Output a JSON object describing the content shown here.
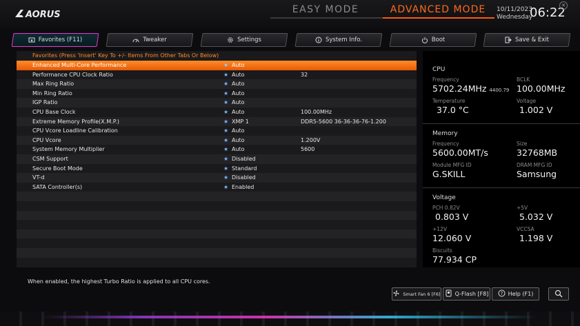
{
  "header": {
    "logo_text": "AORUS",
    "easy_mode": "EASY MODE",
    "advanced_mode": "ADVANCED MODE",
    "date": "10/11/2023",
    "weekday": "Wednesday",
    "time": "06:22",
    "accent_color": "#ff5a0a"
  },
  "tabs": [
    {
      "label": "Favorites (F11)",
      "icon": "favorites-icon",
      "active": true
    },
    {
      "label": "Tweaker",
      "icon": "speedometer-icon",
      "active": false
    },
    {
      "label": "Settings",
      "icon": "gear-icon",
      "active": false
    },
    {
      "label": "System Info.",
      "icon": "info-icon",
      "active": false
    },
    {
      "label": "Boot",
      "icon": "power-icon",
      "active": false
    },
    {
      "label": "Save & Exit",
      "icon": "exit-icon",
      "active": false
    }
  ],
  "favorites": {
    "title": "Favorites (Press 'Insert' Key To +/- Items From Other Tabs Or Below)",
    "rows": [
      {
        "name": "Enhanced Multi-Core Performance",
        "value": "Auto",
        "extra": ""
      },
      {
        "name": "Performance CPU Clock Ratio",
        "value": "Auto",
        "extra": "32"
      },
      {
        "name": "Max Ring Ratio",
        "value": "Auto",
        "extra": ""
      },
      {
        "name": "Min Ring Ratio",
        "value": "Auto",
        "extra": ""
      },
      {
        "name": "IGP Ratio",
        "value": "Auto",
        "extra": ""
      },
      {
        "name": "CPU Base Clock",
        "value": "Auto",
        "extra": "100.00MHz"
      },
      {
        "name": "Extreme Memory Profile(X.M.P.)",
        "value": "XMP 1",
        "extra": "DDR5-5600 36-36-36-76-1.200"
      },
      {
        "name": "CPU Vcore Loadline Calibration",
        "value": "Auto",
        "extra": ""
      },
      {
        "name": "CPU Vcore",
        "value": "Auto",
        "extra": "1.200V"
      },
      {
        "name": "System Memory Multiplier",
        "value": "Auto",
        "extra": "5600"
      },
      {
        "name": "CSM Support",
        "value": "Disabled",
        "extra": ""
      },
      {
        "name": "Secure Boot Mode",
        "value": "Standard",
        "extra": ""
      },
      {
        "name": "VT-d",
        "value": "Disabled",
        "extra": ""
      },
      {
        "name": "SATA Controller(s)",
        "value": "Enabled",
        "extra": ""
      }
    ]
  },
  "help_text": "When enabled, the highest Turbo Ratio is applied to all CPU cores.",
  "cpu": {
    "title": "CPU",
    "frequency_label": "Frequency",
    "frequency": "5702.24MHz",
    "frequency_sub": "4400.79",
    "bclk_label": "BCLK",
    "bclk": "100.00MHz",
    "temperature_label": "Temperature",
    "temperature": "37.0 °C",
    "voltage_label": "Voltage",
    "voltage": "1.002 V"
  },
  "memory": {
    "title": "Memory",
    "frequency_label": "Frequency",
    "frequency": "5600.00MT/s",
    "size_label": "Size",
    "size": "32768MB",
    "module_label": "Module MFG ID",
    "module": "G.SKILL",
    "dram_label": "DRAM MFG ID",
    "dram": "Samsung"
  },
  "voltage": {
    "title": "Voltage",
    "pch_label": "PCH 0.82V",
    "pch": "0.803 V",
    "p5v_label": "+5V",
    "p5v": "5.032 V",
    "p12v_label": "+12V",
    "p12v": "12.060 V",
    "vccsa_label": "VCCSA",
    "vccsa": "1.198 V",
    "biscuits_label": "Biscuits",
    "biscuits": "77.934 CP"
  },
  "bottom_buttons": {
    "smart_fan": "Smart Fan 6 [F6]",
    "qflash": "Q-Flash [F8]",
    "help": "Help (F1)"
  }
}
